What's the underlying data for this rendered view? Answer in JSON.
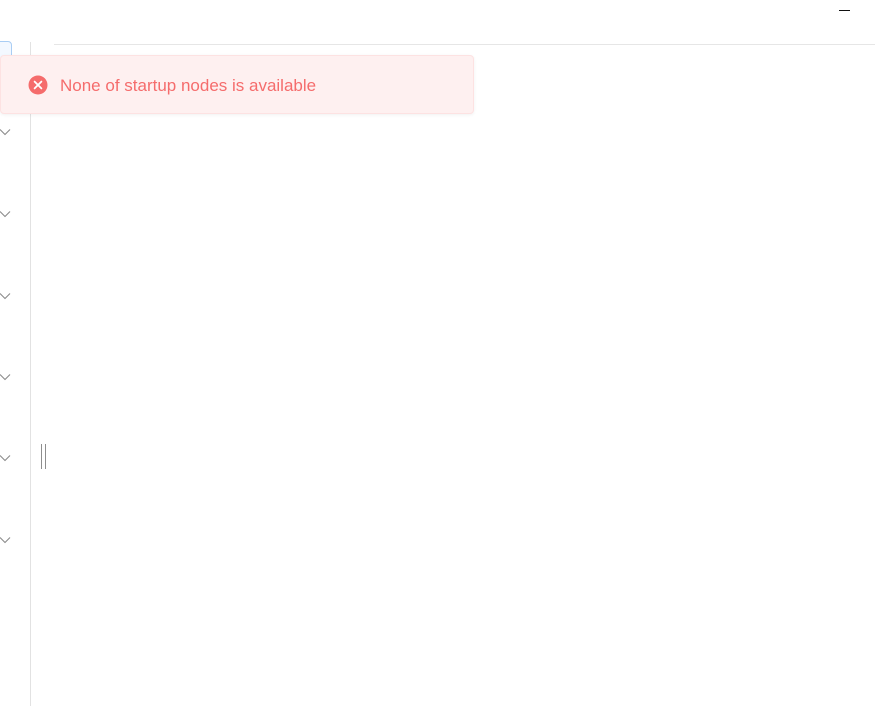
{
  "window": {
    "minimize_icon": "minimize-icon"
  },
  "sidebar": {
    "chevron_icon": "chevron-down-icon",
    "chevron_count": 6
  },
  "toast": {
    "type": "error",
    "icon": "circle-x-icon",
    "message": "None of startup nodes is available",
    "colors": {
      "background": "#fef0f0",
      "border": "#fde2e2",
      "text": "#f56c6c",
      "icon": "#f56c6c"
    }
  }
}
